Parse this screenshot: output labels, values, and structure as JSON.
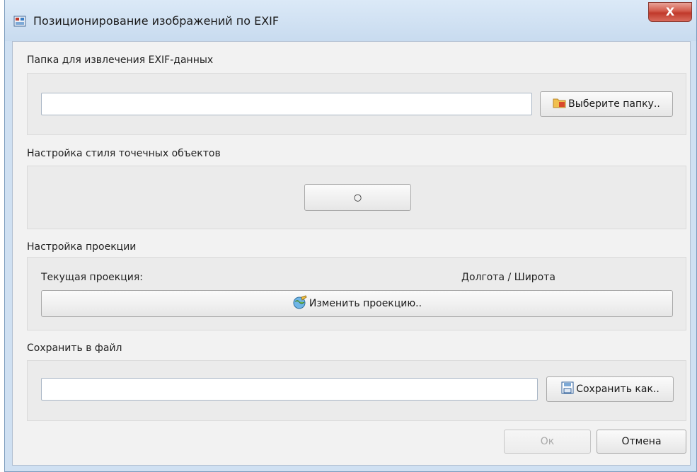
{
  "window": {
    "title": "Позиционирование изображений по EXIF",
    "close_glyph": "X"
  },
  "folder": {
    "label": "Папка для извлечения EXIF-данных",
    "path_value": "",
    "browse_label": "Выберите папку.."
  },
  "style": {
    "label": "Настройка стиля точечных объектов",
    "symbol_glyph": "○"
  },
  "projection": {
    "label": "Настройка проекции",
    "current_label": "Текущая проекция:",
    "current_value": "Долгота / Широта",
    "change_label": "Изменить проекцию.."
  },
  "save": {
    "label": "Сохранить в файл",
    "path_value": "",
    "save_as_label": "Сохранить как.."
  },
  "footer": {
    "ok_label": "Ок",
    "cancel_label": "Отмена"
  },
  "icons": {
    "app": "window-app-icon",
    "folder": "folder-icon",
    "globe": "globe-pencil-icon",
    "save": "save-file-icon"
  }
}
